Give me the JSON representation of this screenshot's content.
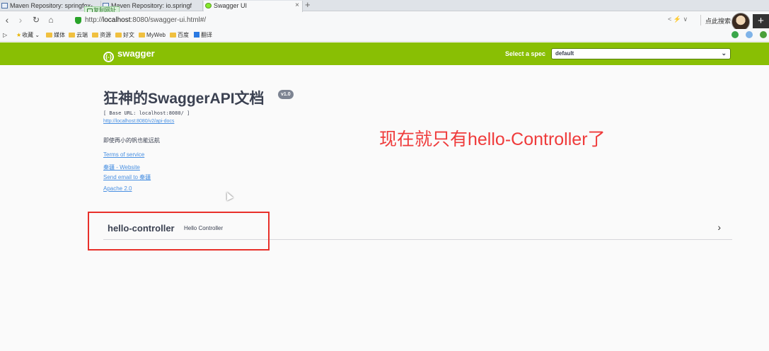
{
  "browser": {
    "tabs": [
      {
        "label": "Maven Repository: springfox-",
        "active": false
      },
      {
        "label": "Maven Repository: io.springf",
        "active": false
      },
      {
        "label": "Swagger UI",
        "active": true
      }
    ],
    "tab_tooltip": "复制网址",
    "url_prefix": "http://",
    "url_host": "localhost",
    "url_rest": ":8080/swagger-ui.html#/",
    "search_placeholder": "点此搜索",
    "bookmarks": [
      "收藏",
      "媒体",
      "云端",
      "资源",
      "好文",
      "MyWeb",
      "百度",
      "翻译"
    ]
  },
  "swagger": {
    "logo_text": "swagger",
    "logo_mark": "{-}",
    "spec_label": "Select a spec",
    "spec_value": "default",
    "title": "狂神的SwaggerAPI文档",
    "version": "v1.0",
    "base_url": "[ Base URL: localhost:8080/ ]",
    "api_docs_url": "http://localhost:8080/v2/api-docs",
    "description": "即使再小的帆也能远航",
    "terms": "Terms of service",
    "contact_website": "秦疆 - Website",
    "contact_email": "Send email to 秦疆",
    "license": "Apache 2.0",
    "tag": {
      "name": "hello-controller",
      "description": "Hello Controller",
      "arrow": "›"
    }
  },
  "annotation": "现在就只有hello-Controller了",
  "colors": {
    "topbar": "#89bf04",
    "link": "#4990e2",
    "annotation": "#ef3b3b",
    "highlight": "#e8302a"
  }
}
